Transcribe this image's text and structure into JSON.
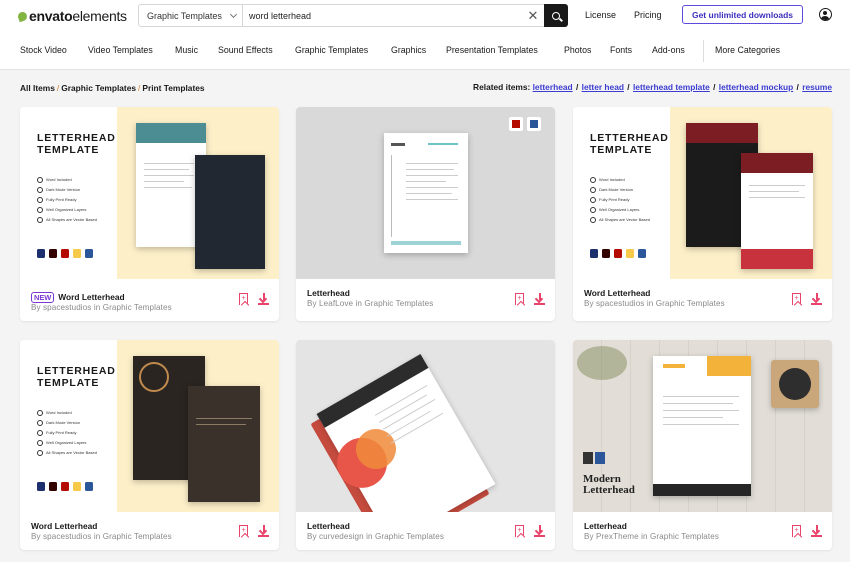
{
  "brand": {
    "name": "envato",
    "suffix": "elements"
  },
  "search": {
    "category": "Graphic Templates",
    "query": "word letterhead"
  },
  "top_links": {
    "license": "License",
    "pricing": "Pricing",
    "cta": "Get unlimited downloads"
  },
  "categories": [
    "Stock Video",
    "Video Templates",
    "Music",
    "Sound Effects",
    "Graphic Templates",
    "Graphics",
    "Presentation Templates",
    "Photos",
    "Fonts",
    "Add-ons",
    "More Categories"
  ],
  "breadcrumb": [
    "All Items",
    "Graphic Templates",
    "Print Templates"
  ],
  "related": {
    "label": "Related items:",
    "items": [
      "letterhead",
      "letter head",
      "letterhead template",
      "letterhead mockup",
      "resume"
    ]
  },
  "colors": {
    "accent": "#e8436a",
    "cta": "#3b2fbd",
    "badge": "#7a37d6",
    "link": "#3d3dd1"
  },
  "cards": [
    {
      "title": "Word Letterhead",
      "badge": "NEW",
      "by": "By",
      "author": "spacestudios",
      "in": "in",
      "category": "Graphic Templates",
      "thumb_title_1": "LETTERHEAD",
      "thumb_title_2": "TEMPLATE",
      "features": [
        "Word Included",
        "Dark Mode Version",
        "Fully Print Ready",
        "Well Organized Layers",
        "All Shapes are Vector Based"
      ]
    },
    {
      "title": "Letterhead",
      "by": "By",
      "author": "LeafLove",
      "in": "in",
      "category": "Graphic Templates"
    },
    {
      "title": "Word Letterhead",
      "by": "By",
      "author": "spacestudios",
      "in": "in",
      "category": "Graphic Templates",
      "thumb_title_1": "LETTERHEAD",
      "thumb_title_2": "TEMPLATE",
      "features": [
        "Word Included",
        "Dark Mode Version",
        "Fully Print Ready",
        "Well Organized Layers",
        "All Shapes are Vector Based"
      ]
    },
    {
      "title": "Word Letterhead",
      "by": "By",
      "author": "spacestudios",
      "in": "in",
      "category": "Graphic Templates",
      "thumb_title_1": "LETTERHEAD",
      "thumb_title_2": "TEMPLATE",
      "features": [
        "Word Included",
        "Dark Mode Version",
        "Fully Print Ready",
        "Well Organized Layers",
        "All Shapes are Vector Based"
      ]
    },
    {
      "title": "Letterhead",
      "by": "By",
      "author": "curvedesign",
      "in": "in",
      "category": "Graphic Templates"
    },
    {
      "title": "Letterhead",
      "by": "By",
      "author": "PrexTheme",
      "in": "in",
      "category": "Graphic Templates",
      "thumb_text_1": "Modern",
      "thumb_text_2": "Letterhead"
    }
  ]
}
